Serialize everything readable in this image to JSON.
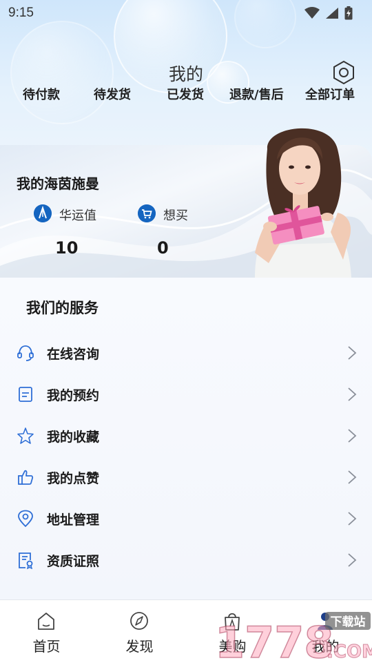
{
  "status_bar": {
    "time": "9:15",
    "icons": [
      "wifi-icon",
      "signal-icon",
      "battery-charging-icon"
    ]
  },
  "header": {
    "title": "我的",
    "settings_icon": "hexagon-settings-icon"
  },
  "order_tabs": [
    "待付款",
    "待发货",
    "已发货",
    "退款/售后",
    "全部订单"
  ],
  "member_card": {
    "title": "我的海茵施曼",
    "stats": [
      {
        "label": "华运值",
        "value": "10",
        "icon": "brand-logo-icon"
      },
      {
        "label": "想买",
        "value": "0",
        "icon": "cart-icon"
      }
    ],
    "accent": "#1565c0"
  },
  "services": {
    "title": "我们的服务",
    "items": [
      {
        "label": "在线咨询",
        "icon": "headset-icon"
      },
      {
        "label": "我的预约",
        "icon": "document-icon"
      },
      {
        "label": "我的收藏",
        "icon": "star-icon"
      },
      {
        "label": "我的点赞",
        "icon": "thumbs-up-icon"
      },
      {
        "label": "地址管理",
        "icon": "location-pin-icon"
      },
      {
        "label": "资质证照",
        "icon": "certificate-icon"
      }
    ]
  },
  "tabbar": {
    "items": [
      {
        "label": "首页",
        "icon": "home-icon"
      },
      {
        "label": "发现",
        "icon": "compass-icon"
      },
      {
        "label": "美购",
        "icon": "shopping-bag-icon"
      },
      {
        "label": "我的",
        "icon": "user-icon",
        "active": true
      }
    ]
  },
  "watermark": {
    "brand": "1778",
    "suffix": ".COM",
    "tag": "下载站"
  },
  "colors": {
    "accent_blue": "#1565c0",
    "icon_blue": "#2f6fd6",
    "background": "#f4f7fd"
  }
}
